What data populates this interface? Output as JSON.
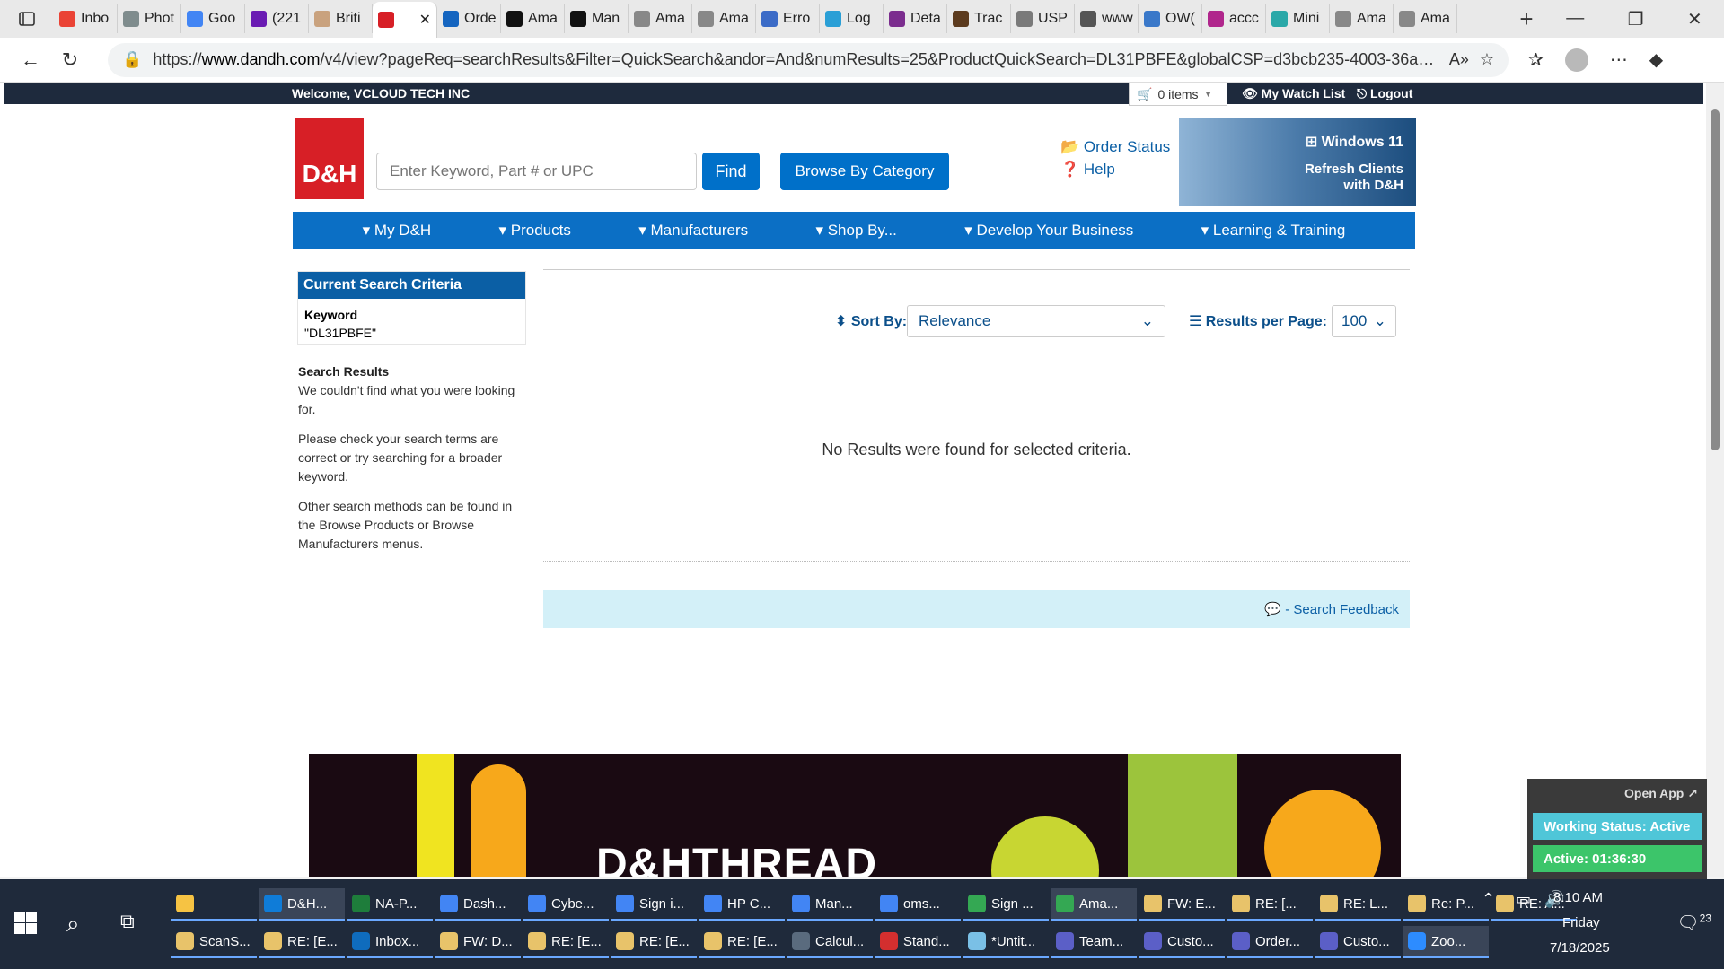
{
  "browser": {
    "tabs": [
      {
        "label": "Inbo",
        "color": "#ea4335"
      },
      {
        "label": "Phot",
        "color": "#7f8c8d"
      },
      {
        "label": "Goo",
        "color": "#4285f4"
      },
      {
        "label": "(221",
        "color": "#6a1bb3"
      },
      {
        "label": "Briti",
        "color": "#c9a27e"
      },
      {
        "label": "",
        "color": "#d71f26",
        "active": true
      },
      {
        "label": "Orde",
        "color": "#1565c0"
      },
      {
        "label": "Ama",
        "color": "#111111"
      },
      {
        "label": "Man",
        "color": "#111111"
      },
      {
        "label": "Ama",
        "color": "#888888"
      },
      {
        "label": "Ama",
        "color": "#888888"
      },
      {
        "label": "Erro",
        "color": "#3b6bc7"
      },
      {
        "label": "Log",
        "color": "#2a9fd6"
      },
      {
        "label": "Deta",
        "color": "#7b2d8e"
      },
      {
        "label": "Trac",
        "color": "#5c3b1e"
      },
      {
        "label": "USP",
        "color": "#7a7a7a"
      },
      {
        "label": "www",
        "color": "#555555"
      },
      {
        "label": "OW(",
        "color": "#3a78c9"
      },
      {
        "label": "accc",
        "color": "#b0268c"
      },
      {
        "label": "Mini",
        "color": "#2aa8a8"
      },
      {
        "label": "Ama",
        "color": "#888888"
      },
      {
        "label": "Ama",
        "color": "#888888"
      }
    ],
    "url_prefix": "https://",
    "url_domain": "www.dandh.com",
    "url_rest": "/v4/view?pageReq=searchResults&Filter=QuickSearch&andor=And&numResults=25&ProductQuickSearch=DL31PBFE&globalCSP=d3bcb235-4003-36ad-..."
  },
  "topbar": {
    "welcome": "Welcome, VCLOUD TECH INC",
    "cart": "0 items",
    "watch_list": "My Watch List",
    "logout": "Logout"
  },
  "header": {
    "logo": "D&H",
    "search_placeholder": "Enter Keyword, Part # or UPC",
    "find": "Find",
    "browse": "Browse By Category",
    "order_status": "Order Status",
    "help": "Help",
    "banner_title": "Windows 11",
    "banner_line1": "Refresh Clients",
    "banner_line2": "with D&H"
  },
  "nav": [
    "My D&H",
    "Products",
    "Manufacturers",
    "Shop By...",
    "Develop Your Business",
    "Learning & Training"
  ],
  "criteria": {
    "title": "Current Search Criteria",
    "key": "Keyword",
    "value": "\"DL31PBFE\""
  },
  "sidebar": {
    "heading": "Search Results",
    "p1": "We couldn't find what you were looking for.",
    "p2": "Please check your search terms are correct or try searching for a broader keyword.",
    "p3": "Other search methods can be found in the Browse Products or Browse Manufacturers menus."
  },
  "results": {
    "sort_label": "Sort By:",
    "sort_value": "Relevance",
    "rpp_label": "Results per Page:",
    "rpp_value": "100",
    "no_results": "No Results were found for selected criteria.",
    "feedback": "- Search Feedback"
  },
  "promo": {
    "text": "D&HTHREAD"
  },
  "widget": {
    "open_app": "Open App",
    "working_status": "Working Status: Active",
    "active_time": "Active: 01:36:30"
  },
  "taskbar": {
    "row1": [
      {
        "label": "",
        "color": "#f6c343"
      },
      {
        "label": "D&H...",
        "color": "#0f7cd8",
        "active": true
      },
      {
        "label": "NA-P...",
        "color": "#1e7d3b"
      },
      {
        "label": "Dash...",
        "color": "#4285f4"
      },
      {
        "label": "Cybe...",
        "color": "#4285f4"
      },
      {
        "label": "Sign i...",
        "color": "#4285f4"
      },
      {
        "label": "HP C...",
        "color": "#4285f4"
      },
      {
        "label": "Man...",
        "color": "#4285f4"
      },
      {
        "label": "oms...",
        "color": "#4285f4"
      },
      {
        "label": "Sign ...",
        "color": "#34a853"
      },
      {
        "label": "Ama...",
        "color": "#34a853",
        "active": true
      },
      {
        "label": "FW: E...",
        "color": "#e8c36a"
      },
      {
        "label": "RE: [...",
        "color": "#e8c36a"
      },
      {
        "label": "RE: L...",
        "color": "#e8c36a"
      },
      {
        "label": "Re: P...",
        "color": "#e8c36a"
      },
      {
        "label": "RE: A...",
        "color": "#e8c36a"
      }
    ],
    "row2": [
      {
        "label": "ScanS...",
        "color": "#e8c36a"
      },
      {
        "label": "RE: [E...",
        "color": "#e8c36a"
      },
      {
        "label": "Inbox...",
        "color": "#0f6cbd"
      },
      {
        "label": "FW: D...",
        "color": "#e8c36a"
      },
      {
        "label": "RE: [E...",
        "color": "#e8c36a"
      },
      {
        "label": "RE: [E...",
        "color": "#e8c36a"
      },
      {
        "label": "RE: [E...",
        "color": "#e8c36a"
      },
      {
        "label": "Calcul...",
        "color": "#5a6b7e"
      },
      {
        "label": "Stand...",
        "color": "#d32f2f"
      },
      {
        "label": "*Untit...",
        "color": "#7ac0e6"
      },
      {
        "label": "Team...",
        "color": "#5b5fc7"
      },
      {
        "label": "Custo...",
        "color": "#5b5fc7"
      },
      {
        "label": "Order...",
        "color": "#5b5fc7"
      },
      {
        "label": "Custo...",
        "color": "#5b5fc7"
      },
      {
        "label": "Zoo...",
        "color": "#2d8cff",
        "active": true
      }
    ],
    "time": "8:10 AM",
    "day": "Friday",
    "date": "7/18/2025",
    "notifications": "23"
  }
}
